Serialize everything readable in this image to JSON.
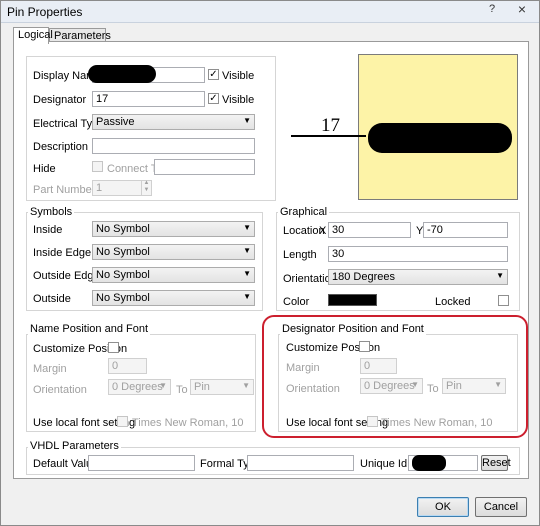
{
  "window": {
    "title": "Pin Properties",
    "help": "?",
    "close": "×"
  },
  "tabs": [
    "Logical",
    "Parameters"
  ],
  "pin": {
    "display_name_label": "Display Name",
    "display_name_visible_label": "Visible",
    "designator_label": "Designator",
    "designator_value": "17",
    "designator_visible_label": "Visible",
    "electrical_type_label": "Electrical Type",
    "electrical_type_value": "Passive",
    "description_label": "Description",
    "description_value": "",
    "hide_label": "Hide",
    "connect_to_label": "Connect To",
    "part_number_label": "Part Number",
    "part_number_value": "1"
  },
  "preview": {
    "designator": "17",
    "background": "#fdf3a7"
  },
  "symbols": {
    "title": "Symbols",
    "inside_label": "Inside",
    "inside_value": "No Symbol",
    "inside_edge_label": "Inside Edge",
    "inside_edge_value": "No Symbol",
    "outside_edge_label": "Outside Edge",
    "outside_edge_value": "No Symbol",
    "outside_label": "Outside",
    "outside_value": "No Symbol"
  },
  "graphical": {
    "title": "Graphical",
    "location_label": "Location",
    "x_label": "X",
    "x_value": "30",
    "y_label": "Y",
    "y_value": "-70",
    "length_label": "Length",
    "length_value": "30",
    "orientation_label": "Orientation",
    "orientation_value": "180 Degrees",
    "color_label": "Color",
    "locked_label": "Locked"
  },
  "name_position": {
    "title": "Name Position and Font",
    "customize_label": "Customize Position",
    "margin_label": "Margin",
    "margin_value": "0",
    "orientation_label": "Orientation",
    "orientation_value": "0 Degrees",
    "to_label": "To",
    "to_value": "Pin",
    "font_label": "Use local font setting",
    "font_value": "Times New Roman, 10"
  },
  "designator_position": {
    "title": "Designator Position and Font",
    "customize_label": "Customize Position",
    "margin_label": "Margin",
    "margin_value": "0",
    "orientation_label": "Orientation",
    "orientation_value": "0 Degrees",
    "to_label": "To",
    "to_value": "Pin",
    "font_label": "Use local font setting",
    "font_value": "Times New Roman, 10",
    "highlight_color": "#cc1f2e"
  },
  "vhdl": {
    "title": "VHDL Parameters",
    "default_value_label": "Default Value",
    "formal_type_label": "Formal Type",
    "unique_id_label": "Unique Id",
    "reset_label": "Reset"
  },
  "buttons": {
    "ok": "OK",
    "cancel": "Cancel"
  }
}
